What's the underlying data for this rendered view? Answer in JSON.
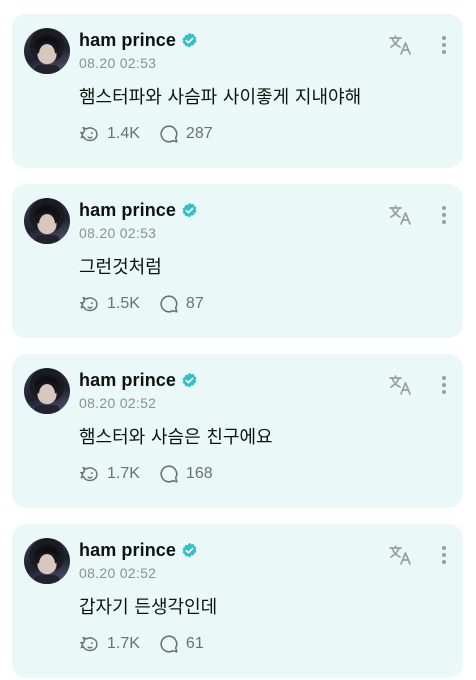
{
  "posts": [
    {
      "author": "ham prince",
      "time": "08.20 02:53",
      "text": "햄스터파와 사슴파 사이좋게 지내야해",
      "likes": "1.4K",
      "comments": "287"
    },
    {
      "author": "ham prince",
      "time": "08.20 02:53",
      "text": "그런것처럼",
      "likes": "1.5K",
      "comments": "87"
    },
    {
      "author": "ham prince",
      "time": "08.20 02:52",
      "text": "햄스터와 사슴은 친구에요",
      "likes": "1.7K",
      "comments": "168"
    },
    {
      "author": "ham prince",
      "time": "08.20 02:52",
      "text": "갑자기 든생각인데",
      "likes": "1.7K",
      "comments": "61"
    }
  ],
  "icons": {
    "verified": "verified-badge-icon",
    "like": "hamster-paw-like-icon",
    "comment": "speech-bubble-icon",
    "translate": "translate-icon",
    "more": "more-vertical-icon"
  },
  "colors": {
    "card_background": "#eaf9f7",
    "verified_badge": "#34c0c8",
    "secondary_text": "#8b8f94"
  }
}
